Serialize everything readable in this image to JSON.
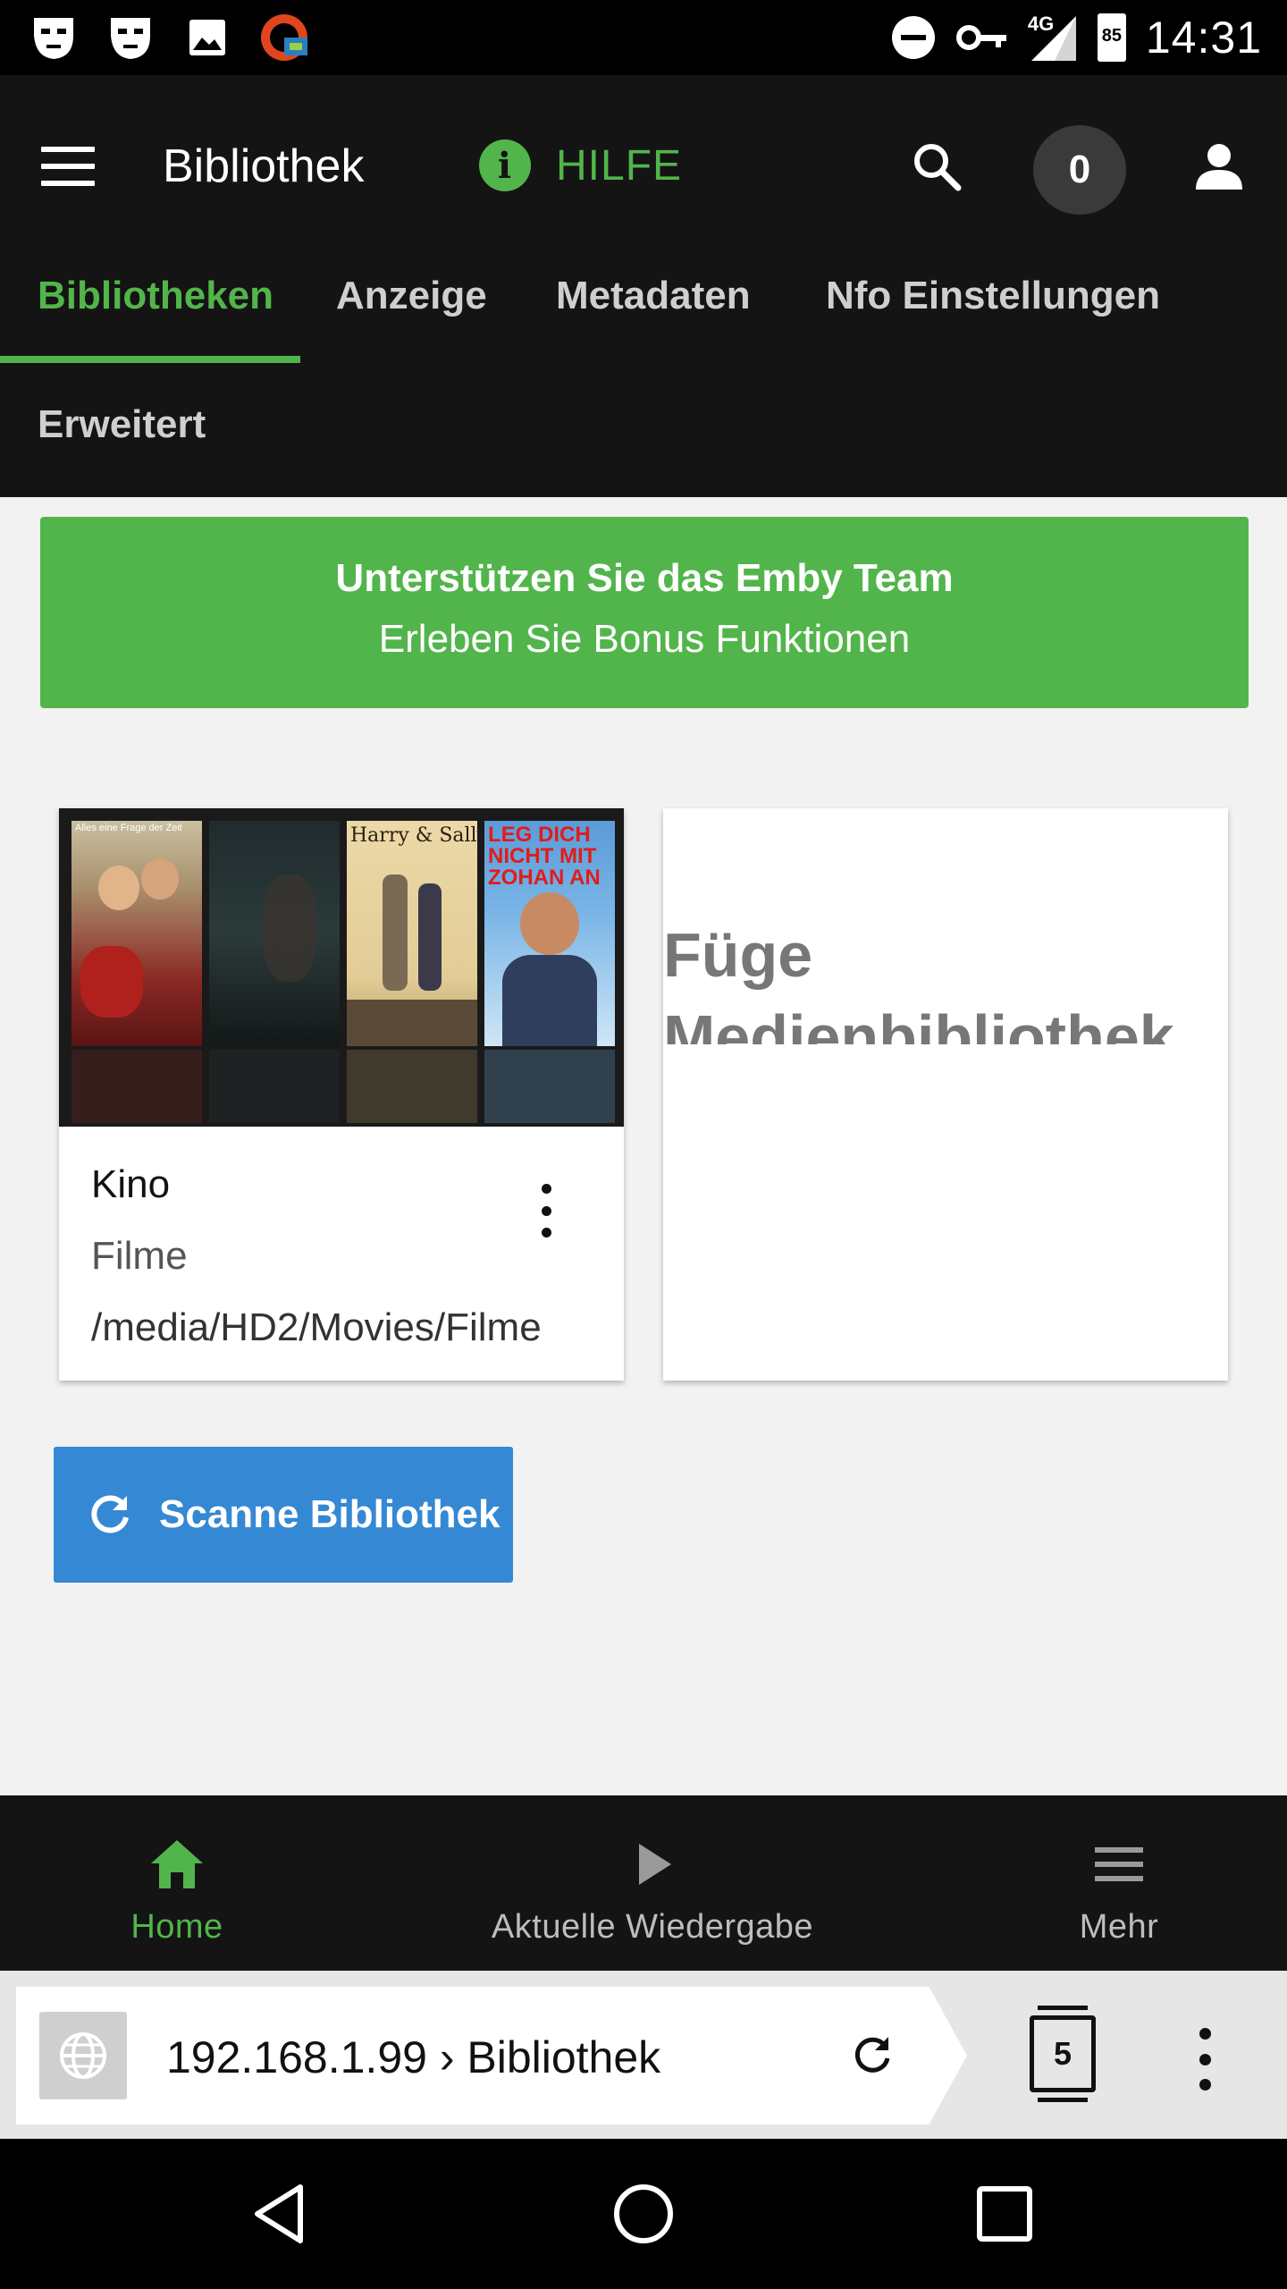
{
  "status_bar": {
    "time": "14:31",
    "network": "4G",
    "battery": "85",
    "left_icons": [
      "mask-icon",
      "mask-icon",
      "image-icon",
      "vpn-icon"
    ],
    "right_icons": [
      "do-not-disturb-icon",
      "vpn-key-icon",
      "signal-icon",
      "battery-icon"
    ]
  },
  "header": {
    "title": "Bibliothek",
    "help_label": "HILFE",
    "help_icon": "i",
    "badge_count": "0",
    "accent_color": "#52b54b"
  },
  "tabs": [
    {
      "label": "Bibliotheken",
      "active": true
    },
    {
      "label": "Anzeige",
      "active": false
    },
    {
      "label": "Metadaten",
      "active": false
    },
    {
      "label": "Nfo Einstellungen",
      "active": false
    },
    {
      "label": "Erweitert",
      "active": false
    }
  ],
  "promo": {
    "title": "Unterstützen Sie das Emby Team",
    "subtitle": "Erleben Sie Bonus Funktionen",
    "color": "#52b54b"
  },
  "library_card": {
    "name": "Kino",
    "type": "Filme",
    "path": "/media/HD2/Movies/Filme",
    "posters": [
      {
        "caption": "Alles eine Frage der Zeit"
      },
      {
        "caption": ""
      },
      {
        "caption": "Harry & Sally"
      },
      {
        "caption": "LEG DICH NICHT MIT ZOHAN AN"
      }
    ]
  },
  "add_card": {
    "label": "Füge Medienbibliothek hinzu"
  },
  "scan_button": {
    "label": "Scanne Bibliothek",
    "color": "#3588d3"
  },
  "bottom_nav": [
    {
      "label": "Home",
      "icon": "home-icon",
      "active": true
    },
    {
      "label": "Aktuelle Wiedergabe",
      "icon": "play-icon",
      "active": false
    },
    {
      "label": "Mehr",
      "icon": "menu-icon",
      "active": false
    }
  ],
  "browser": {
    "url": "192.168.1.99 › Bibliothek",
    "tab_count": "5"
  }
}
